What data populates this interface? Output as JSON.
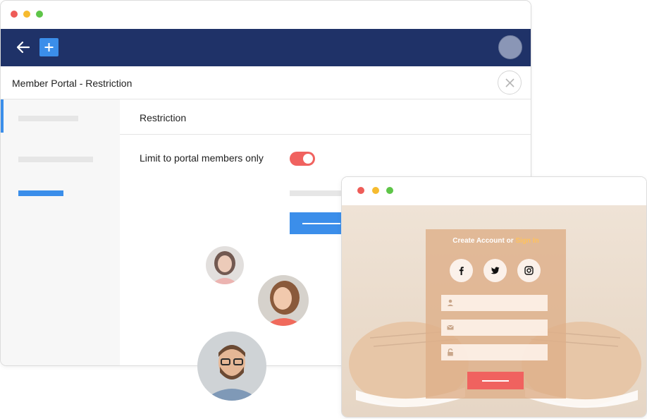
{
  "main_window": {
    "header": {
      "title": "Member Portal - Restriction"
    },
    "content": {
      "section_title": "Restriction",
      "limit_label": "Limit to portal members only",
      "limit_toggle_on": true
    },
    "sidebar": {
      "active_index": 0,
      "items": [
        "placeholder",
        "placeholder",
        "placeholder-blue"
      ]
    }
  },
  "signup_window": {
    "heading_prefix": "Create Account or ",
    "heading_link": "Sign In",
    "social": [
      "facebook-icon",
      "twitter-icon",
      "instagram-icon"
    ],
    "fields": [
      "user-icon",
      "mail-icon",
      "lock-icon"
    ]
  },
  "colors": {
    "appbar": "#1f3268",
    "accent_blue": "#3b8eea",
    "toggle_red": "#f0625f",
    "signin_link": "#ffc25c"
  }
}
